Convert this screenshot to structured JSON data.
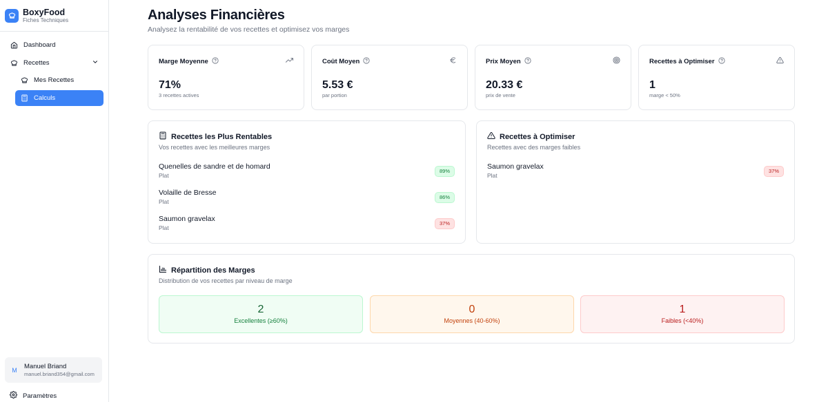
{
  "brand": {
    "name": "BoxyFood",
    "subtitle": "Fiches Techniques"
  },
  "nav": {
    "dashboard": "Dashboard",
    "recettes": "Recettes",
    "mes_recettes": "Mes Recettes",
    "calculs": "Calculs",
    "parametres": "Paramètres"
  },
  "user": {
    "initial": "M",
    "name": "Manuel Briand",
    "email": "manuel.briand354@gmail.com"
  },
  "header": {
    "title": "Analyses Financières",
    "subtitle": "Analysez la rentabilité de vos recettes et optimisez vos marges"
  },
  "stats": [
    {
      "label": "Marge Moyenne",
      "value": "71%",
      "note": "3 recettes actives",
      "icon": "trending-up-icon"
    },
    {
      "label": "Coût Moyen",
      "value": "5.53 €",
      "note": "par portion",
      "icon": "euro-icon"
    },
    {
      "label": "Prix Moyen",
      "value": "20.33 €",
      "note": "prix de vente",
      "icon": "target-icon"
    },
    {
      "label": "Recettes à Optimiser",
      "value": "1",
      "note": "marge < 50%",
      "icon": "warning-icon"
    }
  ],
  "top_recipes": {
    "title": "Recettes les Plus Rentables",
    "description": "Vos recettes avec les meilleures marges",
    "items": [
      {
        "name": "Quenelles de sandre et de homard",
        "category": "Plat",
        "margin": "89%",
        "status": "good"
      },
      {
        "name": "Volaille de Bresse",
        "category": "Plat",
        "margin": "86%",
        "status": "good"
      },
      {
        "name": "Saumon gravelax",
        "category": "Plat",
        "margin": "37%",
        "status": "bad"
      }
    ]
  },
  "optimize": {
    "title": "Recettes à Optimiser",
    "description": "Recettes avec des marges faibles",
    "items": [
      {
        "name": "Saumon gravelax",
        "category": "Plat",
        "margin": "37%",
        "status": "bad"
      }
    ]
  },
  "distribution": {
    "title": "Répartition des Marges",
    "description": "Distribution de vos recettes par niveau de marge",
    "buckets": [
      {
        "count": "2",
        "label": "Excellentes (≥60%)",
        "color": "#15803d"
      },
      {
        "count": "0",
        "label": "Moyennes (40-60%)",
        "color": "#c2410c"
      },
      {
        "count": "1",
        "label": "Faibles (<40%)",
        "color": "#b91c1c"
      }
    ]
  }
}
